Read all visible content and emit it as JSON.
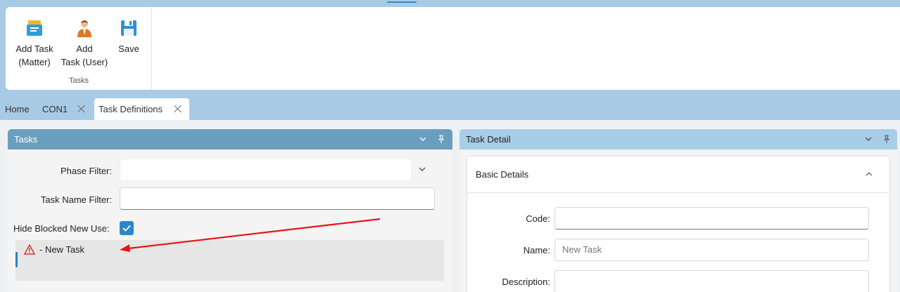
{
  "ribbon": {
    "buttons": [
      {
        "label": "Add Task\n(Matter)",
        "icon": "task-tray-icon"
      },
      {
        "label": "Add\nTask (User)",
        "icon": "user-icon"
      },
      {
        "label": "Save",
        "icon": "save-icon"
      }
    ],
    "group_label": "Tasks"
  },
  "tabs": [
    {
      "label": "Home",
      "closable": false,
      "active": false
    },
    {
      "label": "CON1",
      "closable": true,
      "active": false
    },
    {
      "label": "Task Definitions",
      "closable": true,
      "active": true
    }
  ],
  "tasks_panel": {
    "title": "Tasks",
    "phase_filter_label": "Phase Filter:",
    "phase_filter_value": "",
    "task_name_filter_label": "Task Name Filter:",
    "task_name_filter_value": "",
    "hide_blocked_label": "Hide Blocked New Use:",
    "hide_blocked_checked": true,
    "list_item": {
      "icon": "warning-icon",
      "text": "- New Task"
    }
  },
  "detail_panel": {
    "title": "Task Detail",
    "section_title": "Basic Details",
    "code_label": "Code:",
    "code_value": "",
    "name_label": "Name:",
    "name_placeholder": "New Task",
    "description_label": "Description:",
    "description_value": ""
  },
  "colors": {
    "background": "#a7cbe4",
    "tasks_header": "#6a9ebf",
    "detail_header": "#a8cde8",
    "accent": "#2e86c8",
    "annotation_arrow": "#e8141a"
  }
}
